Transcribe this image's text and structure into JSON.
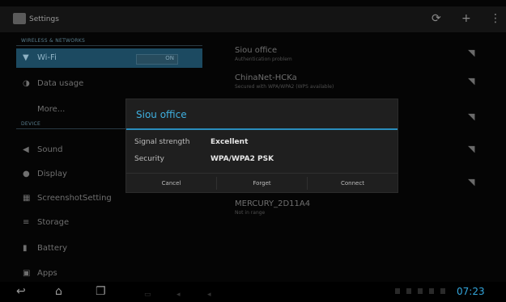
{
  "actionbar": {
    "title": "Settings",
    "icons": [
      "refresh-icon",
      "add-icon",
      "overflow-menu-icon"
    ]
  },
  "left": {
    "sections": [
      {
        "header": "WIRELESS & NETWORKS"
      },
      {
        "header": "DEVICE"
      }
    ],
    "items": [
      {
        "label": "Wi-Fi",
        "icon": "wifi-icon",
        "toggle": "ON",
        "selected": true
      },
      {
        "label": "Data usage",
        "icon": "data-usage-icon"
      },
      {
        "label": "More...",
        "icon": ""
      },
      {
        "label": "Sound",
        "icon": "speaker-icon"
      },
      {
        "label": "Display",
        "icon": "display-icon"
      },
      {
        "label": "ScreenshotSetting",
        "icon": "screenshot-icon"
      },
      {
        "label": "Storage",
        "icon": "storage-icon"
      },
      {
        "label": "Battery",
        "icon": "battery-icon"
      },
      {
        "label": "Apps",
        "icon": "apps-icon"
      }
    ]
  },
  "networks": [
    {
      "name": "Siou office",
      "status": "Authentication problem"
    },
    {
      "name": "ChinaNet-HCKa",
      "status": "Secured with WPA/WPA2 (WPS available)"
    },
    {
      "name": "",
      "status": ""
    },
    {
      "name": "",
      "status": ""
    },
    {
      "name": "",
      "status": ""
    },
    {
      "name": "MERCURY_2D11A4",
      "status": "Not in range"
    }
  ],
  "dialog": {
    "title": "Siou office",
    "rows": [
      {
        "label": "Signal strength",
        "value": "Excellent"
      },
      {
        "label": "Security",
        "value": "WPA/WPA2 PSK"
      }
    ],
    "buttons": {
      "cancel": "Cancel",
      "forget": "Forget",
      "connect": "Connect"
    }
  },
  "navbar": {
    "icons": [
      "back-icon",
      "home-icon",
      "recent-apps-icon"
    ],
    "clock": "07:23"
  },
  "colors": {
    "accent": "#33a6dc",
    "selected": "#1c4a61"
  }
}
